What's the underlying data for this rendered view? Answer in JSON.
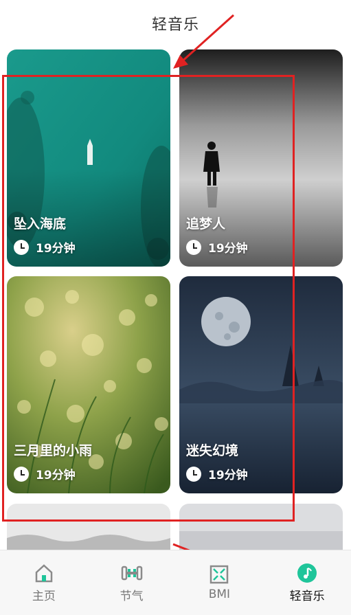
{
  "header": {
    "title": "轻音乐"
  },
  "cards": [
    {
      "name": "坠入海底",
      "duration": "19分钟"
    },
    {
      "name": "追梦人",
      "duration": "19分钟"
    },
    {
      "name": "三月里的小雨",
      "duration": "19分钟"
    },
    {
      "name": "迷失幻境",
      "duration": "19分钟"
    }
  ],
  "tabbar": {
    "items": [
      {
        "label": "主页",
        "icon": "home-icon"
      },
      {
        "label": "节气",
        "icon": "dumbbell-icon"
      },
      {
        "label": "BMI",
        "icon": "bmi-icon"
      },
      {
        "label": "轻音乐",
        "icon": "music-note-icon"
      }
    ],
    "active_index": 3
  },
  "colors": {
    "accent": "#1fc59a",
    "annotation": "#e02222",
    "icon_gray": "#8a8a8a"
  }
}
